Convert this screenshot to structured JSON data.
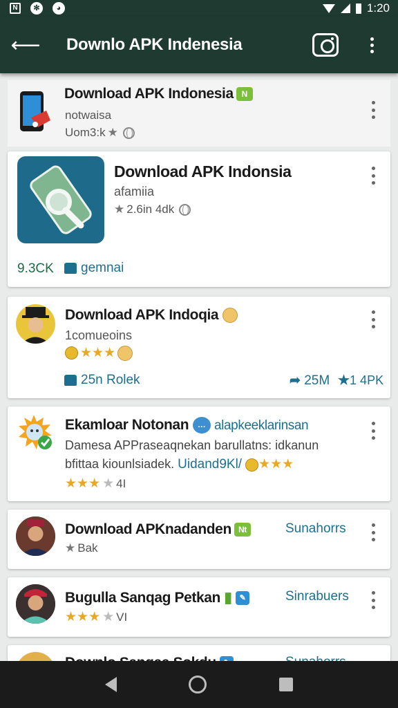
{
  "status_bar": {
    "time": "1:20",
    "left_icons": [
      "notification-n-icon",
      "settings-cog-icon",
      "cat-app-icon"
    ],
    "right_icons": [
      "wifi-icon",
      "signal-icon",
      "battery-icon"
    ]
  },
  "app_bar": {
    "title": "Downlo APK Indenesia",
    "icons": [
      "back-arrow-icon",
      "camera-icon",
      "more-vert-icon"
    ]
  },
  "items": [
    {
      "title": "Download APK Indonesia",
      "badge": "N",
      "subtitle": "notwaisa",
      "meta": "Uom3:k"
    },
    {
      "title": "Download APK Indonsia",
      "subtitle": "afamiia",
      "meta": "2.6in 4dk",
      "count": "9.3CK",
      "likes": "gemnai"
    },
    {
      "title": "Download APK Indoqia",
      "subtitle": "1comueoins",
      "likes": "25n Rolek",
      "shares": "25M",
      "stars_count": "1 4PK"
    },
    {
      "title": "Ekamloar Notonan",
      "link": "alapkeeklarinsan",
      "body_line1": "Damesa APPraseaqnekan barullatns:  idkanun",
      "body_line2": "bfittaa kioun­lsiadek.",
      "body_link": "Uidand9Kl/",
      "rating": "4I"
    },
    {
      "title": "Download APKnadanden",
      "badge": "Nt",
      "action": "Sunahorrs",
      "meta": "Bak"
    },
    {
      "title": "Bugulla Sanqag Petkan",
      "action": "Sinrabuers",
      "rating": "VI"
    },
    {
      "title": "Downlo Sanqaa Sokdu",
      "action": "Sunahorrs"
    }
  ],
  "nav_bar": {
    "icons": [
      "nav-back-icon",
      "nav-home-icon",
      "nav-recents-icon"
    ]
  }
}
